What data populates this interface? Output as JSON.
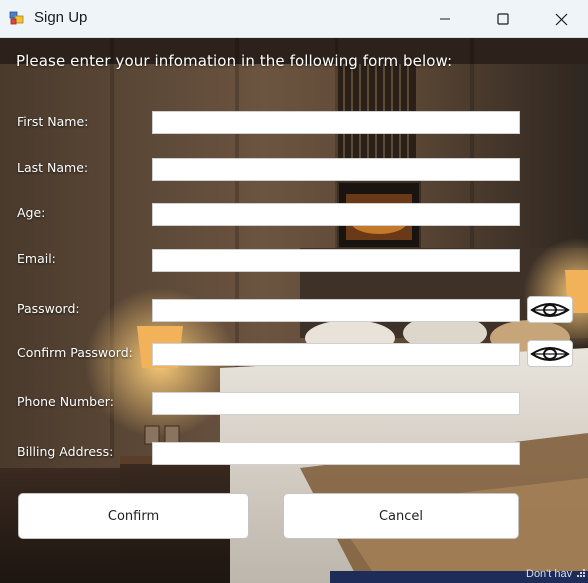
{
  "window": {
    "title": "Sign Up",
    "app_icon": "winforms-app-icon",
    "controls": {
      "minimize": "minimize-icon",
      "maximize": "maximize-icon",
      "close": "close-icon"
    }
  },
  "form": {
    "heading": "Please enter your infomation in the following form below:",
    "fields": [
      {
        "label": "First Name:",
        "value": ""
      },
      {
        "label": "Last Name:",
        "value": ""
      },
      {
        "label": "Age:",
        "value": ""
      },
      {
        "label": "Email:",
        "value": ""
      },
      {
        "label": "Password:",
        "value": ""
      },
      {
        "label": "Confirm Password:",
        "value": ""
      },
      {
        "label": "Phone Number:",
        "value": ""
      },
      {
        "label": "Billing Address:",
        "value": ""
      }
    ],
    "show_password_icon": "eye-icon",
    "confirm_label": "Confirm",
    "cancel_label": "Cancel"
  },
  "background": {
    "description_icon": "hotel-room-photo"
  },
  "footer": {
    "partial_text": "Don't hav"
  }
}
